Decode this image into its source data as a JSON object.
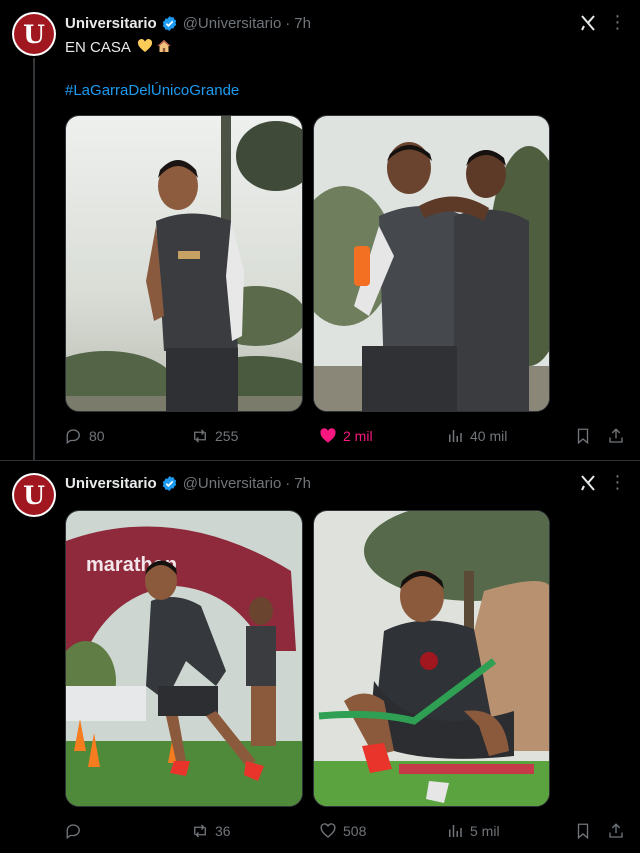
{
  "tweets": [
    {
      "author": {
        "name": "Universitario",
        "handle": "@Universitario",
        "avatar_letter": "U"
      },
      "time": "7h",
      "text": "EN CASA",
      "emojis": [
        "yellow-heart-emoji",
        "house-emoji"
      ],
      "hashtag": "#LaGarraDelÚnicoGrande",
      "images": [
        {
          "icon": "player-smiling-photo"
        },
        {
          "icon": "players-embrace-photo"
        }
      ],
      "stats": {
        "replies": "80",
        "reposts": "255",
        "likes": "2 mil",
        "views": "40 mil"
      },
      "liked": true
    },
    {
      "author": {
        "name": "Universitario",
        "handle": "@Universitario",
        "avatar_letter": "U"
      },
      "time": "7h",
      "images": [
        {
          "icon": "training-drill-photo",
          "tent_text": "marathon"
        },
        {
          "icon": "resistance-band-photo"
        }
      ],
      "stats": {
        "replies": "",
        "reposts": "36",
        "likes": "508",
        "views": "5 mil"
      },
      "liked": false
    }
  ],
  "ui": {
    "dot": "·",
    "colors": {
      "accent": "#1d9bf0",
      "like": "#f91880",
      "muted": "#71767b",
      "brand": "#a0171f"
    }
  }
}
